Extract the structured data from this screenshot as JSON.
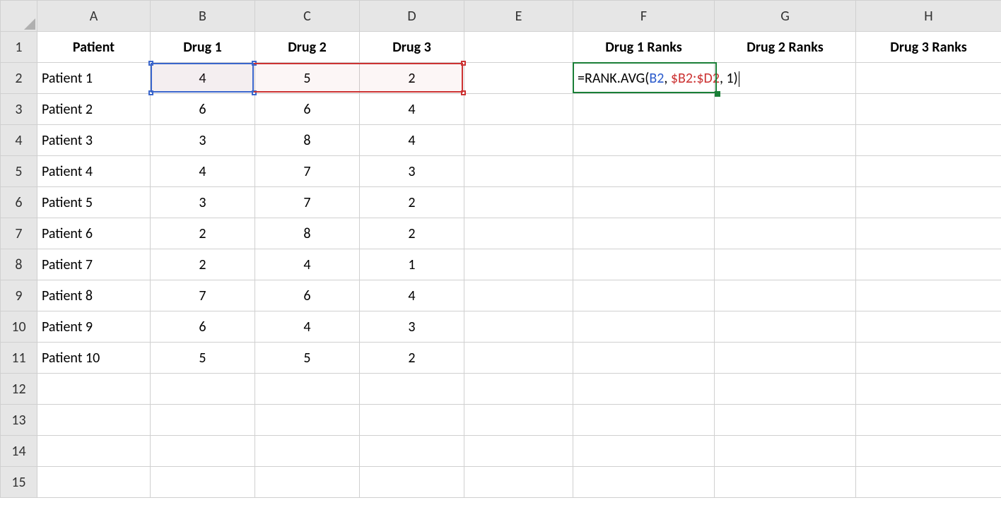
{
  "columns": [
    "A",
    "B",
    "C",
    "D",
    "E",
    "F",
    "G",
    "H"
  ],
  "row_count": 15,
  "headers": {
    "A": "Patient",
    "B": "Drug 1",
    "C": "Drug 2",
    "D": "Drug 3",
    "F": "Drug 1 Ranks",
    "G": "Drug 2 Ranks",
    "H": "Drug 3 Ranks"
  },
  "patients": [
    {
      "name": "Patient 1",
      "d1": "4",
      "d2": "5",
      "d3": "2"
    },
    {
      "name": "Patient 2",
      "d1": "6",
      "d2": "6",
      "d3": "4"
    },
    {
      "name": "Patient 3",
      "d1": "3",
      "d2": "8",
      "d3": "4"
    },
    {
      "name": "Patient 4",
      "d1": "4",
      "d2": "7",
      "d3": "3"
    },
    {
      "name": "Patient 5",
      "d1": "3",
      "d2": "7",
      "d3": "2"
    },
    {
      "name": "Patient 6",
      "d1": "2",
      "d2": "8",
      "d3": "2"
    },
    {
      "name": "Patient 7",
      "d1": "2",
      "d2": "4",
      "d3": "1"
    },
    {
      "name": "Patient 8",
      "d1": "7",
      "d2": "6",
      "d3": "4"
    },
    {
      "name": "Patient 9",
      "d1": "6",
      "d2": "4",
      "d3": "3"
    },
    {
      "name": "Patient 10",
      "d1": "5",
      "d2": "5",
      "d3": "2"
    }
  ],
  "formula": {
    "prefix": "=RANK.AVG(",
    "ref1": "B2",
    "sep1": ", ",
    "ref2": "$B2:$D2",
    "sep2": ", ",
    "arg3": "1",
    "suffix": ")"
  },
  "chart_data": {
    "type": "table",
    "title": "Patient drug scores",
    "columns": [
      "Patient",
      "Drug 1",
      "Drug 2",
      "Drug 3"
    ],
    "rows": [
      [
        "Patient 1",
        4,
        5,
        2
      ],
      [
        "Patient 2",
        6,
        6,
        4
      ],
      [
        "Patient 3",
        3,
        8,
        4
      ],
      [
        "Patient 4",
        4,
        7,
        3
      ],
      [
        "Patient 5",
        3,
        7,
        2
      ],
      [
        "Patient 6",
        2,
        8,
        2
      ],
      [
        "Patient 7",
        2,
        4,
        1
      ],
      [
        "Patient 8",
        7,
        6,
        4
      ],
      [
        "Patient 9",
        6,
        4,
        3
      ],
      [
        "Patient 10",
        5,
        5,
        2
      ]
    ]
  }
}
